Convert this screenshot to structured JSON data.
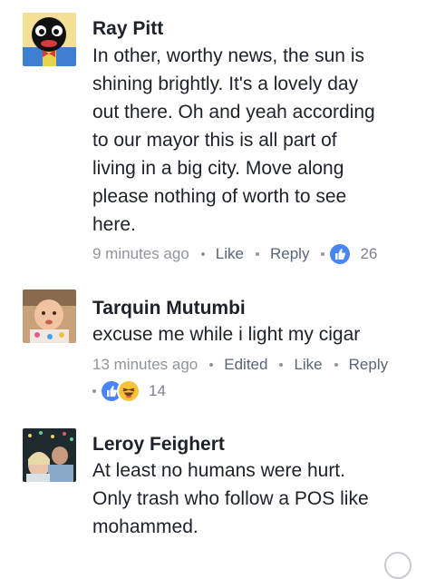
{
  "comments": [
    {
      "author": "Ray Pitt",
      "lines": [
        "In other, worthy news, the sun is",
        "shining brightly. It's a lovely day",
        "out there. Oh and yeah according",
        "to our mayor this is all part of",
        "living in a big city. Move along",
        "please nothing of worth to see",
        "here."
      ],
      "time": "9 minutes ago",
      "like_label": "Like",
      "reply_label": "Reply",
      "reaction_count": "26"
    },
    {
      "author": "Tarquin Mutumbi",
      "lines": [
        "excuse me while i light my cigar"
      ],
      "time": "13 minutes ago",
      "edited_label": "Edited",
      "like_label": "Like",
      "reply_label": "Reply",
      "reaction_count": "14"
    },
    {
      "author": "Leroy Feighert",
      "lines": [
        "At least no humans were hurt.",
        "Only trash who follow a POS like",
        "mohammed."
      ]
    }
  ],
  "colors": {
    "author": "#1d2129",
    "meta": "#90949c",
    "like_blue": "#4a85f5",
    "haha_yellow": "#f7c233"
  },
  "icons": [
    "like-reaction-icon",
    "haha-reaction-icon",
    "loading-spinner-icon"
  ]
}
